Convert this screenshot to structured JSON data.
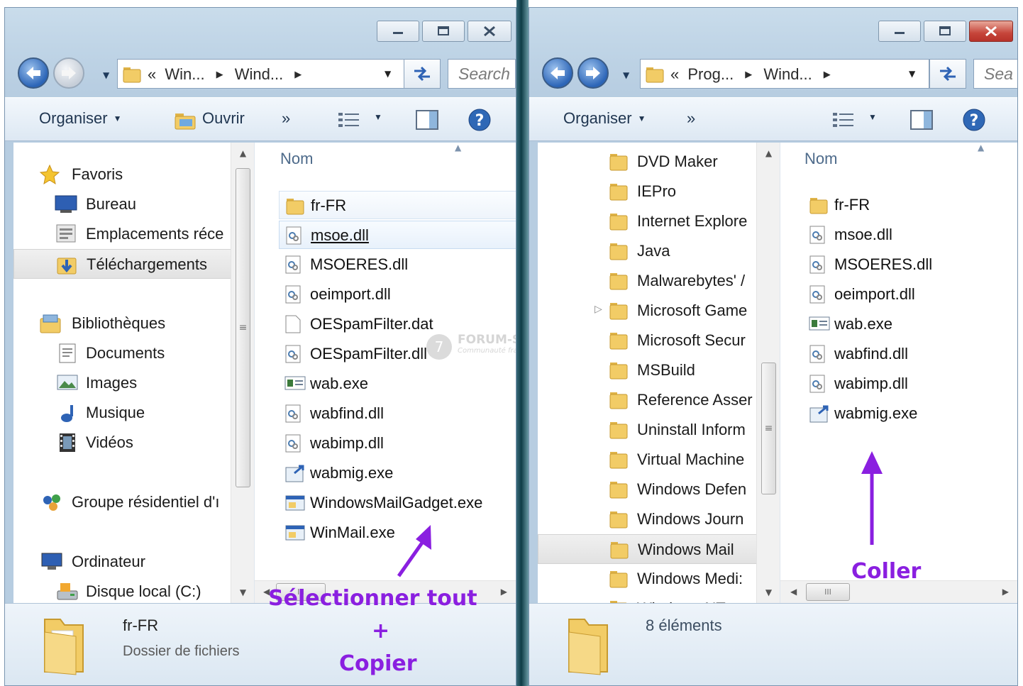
{
  "left_window": {
    "breadcrumb": [
      "«",
      "Win...",
      "Wind..."
    ],
    "search_placeholder": "Search",
    "toolbar": {
      "organize": "Organiser",
      "open": "Ouvrir",
      "more": "»"
    },
    "column_header": "Nom",
    "nav_items": [
      {
        "label": "Favoris",
        "icon": "star-icon"
      },
      {
        "label": "Bureau",
        "icon": "desktop-icon"
      },
      {
        "label": "Emplacements réce",
        "icon": "recent-places-icon"
      },
      {
        "label": "Téléchargements",
        "icon": "downloads-folder-icon",
        "selected": true
      },
      {
        "label": "Bibliothèques",
        "icon": "libraries-icon"
      },
      {
        "label": "Documents",
        "icon": "documents-icon"
      },
      {
        "label": "Images",
        "icon": "pictures-icon"
      },
      {
        "label": "Musique",
        "icon": "music-icon"
      },
      {
        "label": "Vidéos",
        "icon": "videos-icon"
      },
      {
        "label": "Groupe résidentiel d'ı",
        "icon": "homegroup-icon"
      },
      {
        "label": "Ordinateur",
        "icon": "computer-icon"
      },
      {
        "label": "Disque local (C:)",
        "icon": "drive-icon"
      }
    ],
    "files": [
      {
        "name": "fr-FR",
        "icon": "folder-icon"
      },
      {
        "name": "msoe.dll",
        "icon": "dll-icon"
      },
      {
        "name": "MSOERES.dll",
        "icon": "dll-icon"
      },
      {
        "name": "oeimport.dll",
        "icon": "dll-icon"
      },
      {
        "name": "OESpamFilter.dat",
        "icon": "blank-file-icon"
      },
      {
        "name": "OESpamFilter.dll",
        "icon": "dll-icon"
      },
      {
        "name": "wab.exe",
        "icon": "exe-icon"
      },
      {
        "name": "wabfind.dll",
        "icon": "dll-icon"
      },
      {
        "name": "wabimp.dll",
        "icon": "dll-icon"
      },
      {
        "name": "wabmig.exe",
        "icon": "migrate-exe-icon"
      },
      {
        "name": "WindowsMailGadget.exe",
        "icon": "app-exe-icon"
      },
      {
        "name": "WinMail.exe",
        "icon": "app-exe-icon"
      }
    ],
    "details": {
      "name": "fr-FR",
      "type": "Dossier de fichiers"
    }
  },
  "right_window": {
    "breadcrumb": [
      "«",
      "Prog...",
      "Wind..."
    ],
    "search_placeholder": "Sea",
    "toolbar": {
      "organize": "Organiser",
      "more": "»"
    },
    "column_header": "Nom",
    "tree_items": [
      {
        "label": "DVD Maker"
      },
      {
        "label": "IEPro"
      },
      {
        "label": "Internet Explore"
      },
      {
        "label": "Java"
      },
      {
        "label": "Malwarebytes' /"
      },
      {
        "label": "Microsoft Game",
        "expandable": true
      },
      {
        "label": "Microsoft Secur"
      },
      {
        "label": "MSBuild"
      },
      {
        "label": "Reference Asser"
      },
      {
        "label": "Uninstall Inform"
      },
      {
        "label": "Virtual Machine"
      },
      {
        "label": "Windows Defen"
      },
      {
        "label": "Windows Journ"
      },
      {
        "label": "Windows Mail",
        "selected": true
      },
      {
        "label": "Windows Medi:"
      },
      {
        "label": "Windows NT"
      }
    ],
    "files": [
      {
        "name": "fr-FR",
        "icon": "folder-icon"
      },
      {
        "name": "msoe.dll",
        "icon": "dll-icon"
      },
      {
        "name": "MSOERES.dll",
        "icon": "dll-icon"
      },
      {
        "name": "oeimport.dll",
        "icon": "dll-icon"
      },
      {
        "name": "wab.exe",
        "icon": "exe-icon"
      },
      {
        "name": "wabfind.dll",
        "icon": "dll-icon"
      },
      {
        "name": "wabimp.dll",
        "icon": "dll-icon"
      },
      {
        "name": "wabmig.exe",
        "icon": "migrate-exe-icon"
      }
    ],
    "details": {
      "count": "8 éléments"
    }
  },
  "annotations": {
    "select_all": "Sélectionner tout",
    "plus": "+",
    "copy": "Copier",
    "paste": "Coller",
    "color": "#8a1fe0"
  },
  "watermark": {
    "title": "FORUM-SEVEN .com",
    "tagline": "Communauté française sur Windows Seven"
  },
  "scrollbar_glyph": "III"
}
